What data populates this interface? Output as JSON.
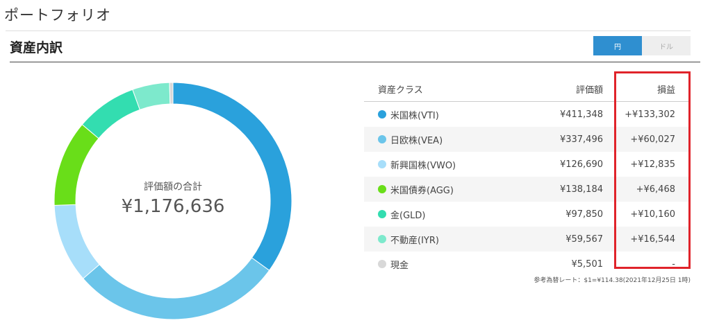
{
  "page": {
    "title": "ポートフォリオ"
  },
  "section": {
    "title": "資産内訳"
  },
  "currency_toggle": {
    "yen": "円",
    "usd": "ドル",
    "selected": "円"
  },
  "summary": {
    "label": "評価額の合計",
    "total": "¥1,176,636"
  },
  "table": {
    "headers": {
      "asset_class": "資産クラス",
      "value": "評価額",
      "gain": "損益"
    },
    "rows": [
      {
        "name": "米国株(VTI)",
        "value": "¥411,348",
        "gain": "+¥133,302",
        "color": "#2aa1dc"
      },
      {
        "name": "日欧株(VEA)",
        "value": "¥337,496",
        "gain": "+¥60,027",
        "color": "#6bc5ea"
      },
      {
        "name": "新興国株(VWO)",
        "value": "¥126,690",
        "gain": "+¥12,835",
        "color": "#a7defa"
      },
      {
        "name": "米国債券(AGG)",
        "value": "¥138,184",
        "gain": "+¥6,468",
        "color": "#69de19"
      },
      {
        "name": "金(GLD)",
        "value": "¥97,850",
        "gain": "+¥10,160",
        "color": "#33ddb0"
      },
      {
        "name": "不動産(IYR)",
        "value": "¥59,567",
        "gain": "+¥16,544",
        "color": "#7de9cc"
      },
      {
        "name": "現金",
        "value": "¥5,501",
        "gain": "-",
        "color": "#d8d8d8"
      }
    ]
  },
  "chart_data": {
    "type": "pie",
    "categories": [
      "米国株(VTI)",
      "日欧株(VEA)",
      "新興国株(VWO)",
      "米国債券(AGG)",
      "金(GLD)",
      "不動産(IYR)",
      "現金"
    ],
    "values": [
      411348,
      337496,
      126690,
      138184,
      97850,
      59567,
      5501
    ],
    "colors": [
      "#2aa1dc",
      "#6bc5ea",
      "#a7defa",
      "#69de19",
      "#33ddb0",
      "#7de9cc",
      "#d8d8d8"
    ]
  },
  "fx_note": "参考為替レート：$1=¥114.38(2021年12月25日 1時)"
}
